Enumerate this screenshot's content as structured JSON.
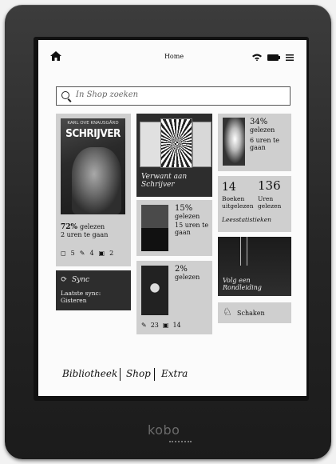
{
  "status_bar": {
    "title": "Home",
    "icons": [
      "home-icon",
      "wifi-icon",
      "battery-icon",
      "menu-icon"
    ]
  },
  "search": {
    "placeholder": "In Shop zoeken"
  },
  "current_book": {
    "author": "KARL OVE KNAUSGÅRD",
    "title": "SCHRIJVER",
    "percent": "72%",
    "percent_suffix": "gelezen",
    "time_left": "2 uren te gaan",
    "bookmarks": "5",
    "annotations": "4",
    "notes": "2"
  },
  "related": {
    "label": "Verwant aan Schrijver"
  },
  "stats_book": {
    "percent": "34%",
    "percent_suffix": "gelezen",
    "time_left": "6 uren te gaan"
  },
  "reading_stats": {
    "books_count": "14",
    "books_label": "Boeken uitgelezen",
    "hours_count": "136",
    "hours_label": "Uren gelezen",
    "link": "Leesstatistieken"
  },
  "book_2": {
    "percent": "15%",
    "percent_suffix": "gelezen",
    "time_left": "15 uren te gaan"
  },
  "book_3": {
    "percent": "2%",
    "percent_suffix": "gelezen",
    "annotations": "23",
    "notes": "14"
  },
  "tour": {
    "label": "Volg een Rondleiding"
  },
  "sync": {
    "label": "Sync",
    "status": "Laatste sync: Gisteren"
  },
  "chess": {
    "label": "Schaken"
  },
  "bottom_nav": {
    "library": "Bibliotheek",
    "shop": "Shop",
    "extra": "Extra"
  },
  "brand": "kobo"
}
